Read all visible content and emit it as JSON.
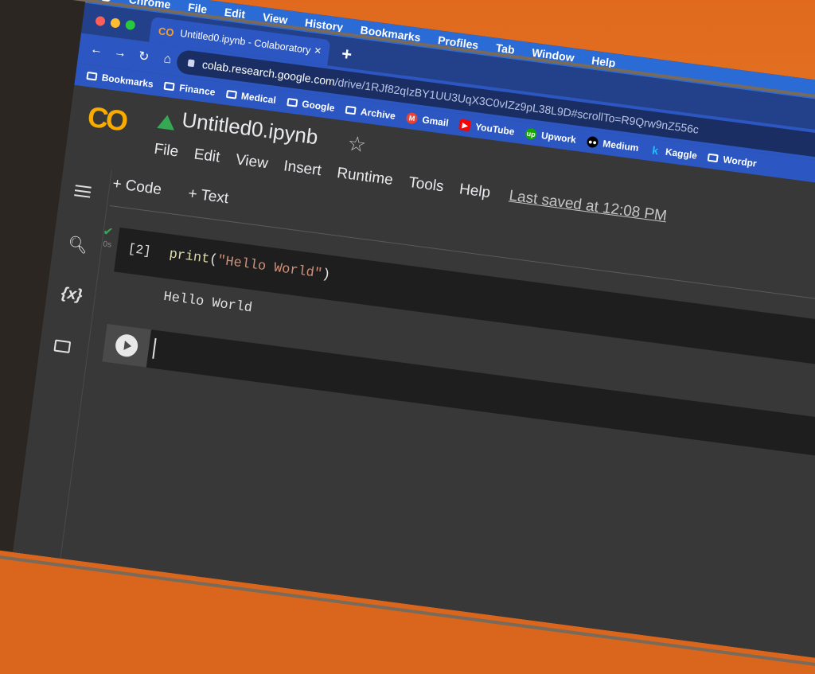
{
  "macos": {
    "app": "Chrome",
    "menu": [
      "File",
      "Edit",
      "View",
      "History",
      "Bookmarks",
      "Profiles",
      "Tab",
      "Window",
      "Help"
    ]
  },
  "browser": {
    "tab_title": "Untitled0.ipynb - Colaboratory",
    "tab_favicon": "CO",
    "new_tab": "+",
    "url_host": "colab.research.google.com",
    "url_path": "/drive/1RJf82qIzBY1UU3UqX3C0vIZz9pL38L9D#scrollTo=R9Qrw9nZ556c",
    "bookmarks": [
      "Bookmarks",
      "Finance",
      "Medical",
      "Google",
      "Archive",
      "Gmail",
      "YouTube",
      "Upwork",
      "Medium",
      "Kaggle",
      "Wordpr"
    ]
  },
  "colab": {
    "logo": "CO",
    "title": "Untitled0.ipynb",
    "menu": [
      "File",
      "Edit",
      "View",
      "Insert",
      "Runtime",
      "Tools",
      "Help"
    ],
    "last_saved": "Last saved at 12:08 PM",
    "toolbar": {
      "code": "+ Code",
      "text": "+ Text"
    },
    "rail": {
      "variables_icon": "{x}"
    },
    "cell": {
      "exec_count": "[2]",
      "exec_time": "0s",
      "code_fn": "print",
      "code_open": "(",
      "code_str": "\"Hello World\"",
      "code_close": ")",
      "output": "Hello World"
    }
  },
  "colors": {
    "accent": "#2c57c2",
    "logo_orange": "#f9ab00",
    "success": "#34a853"
  }
}
